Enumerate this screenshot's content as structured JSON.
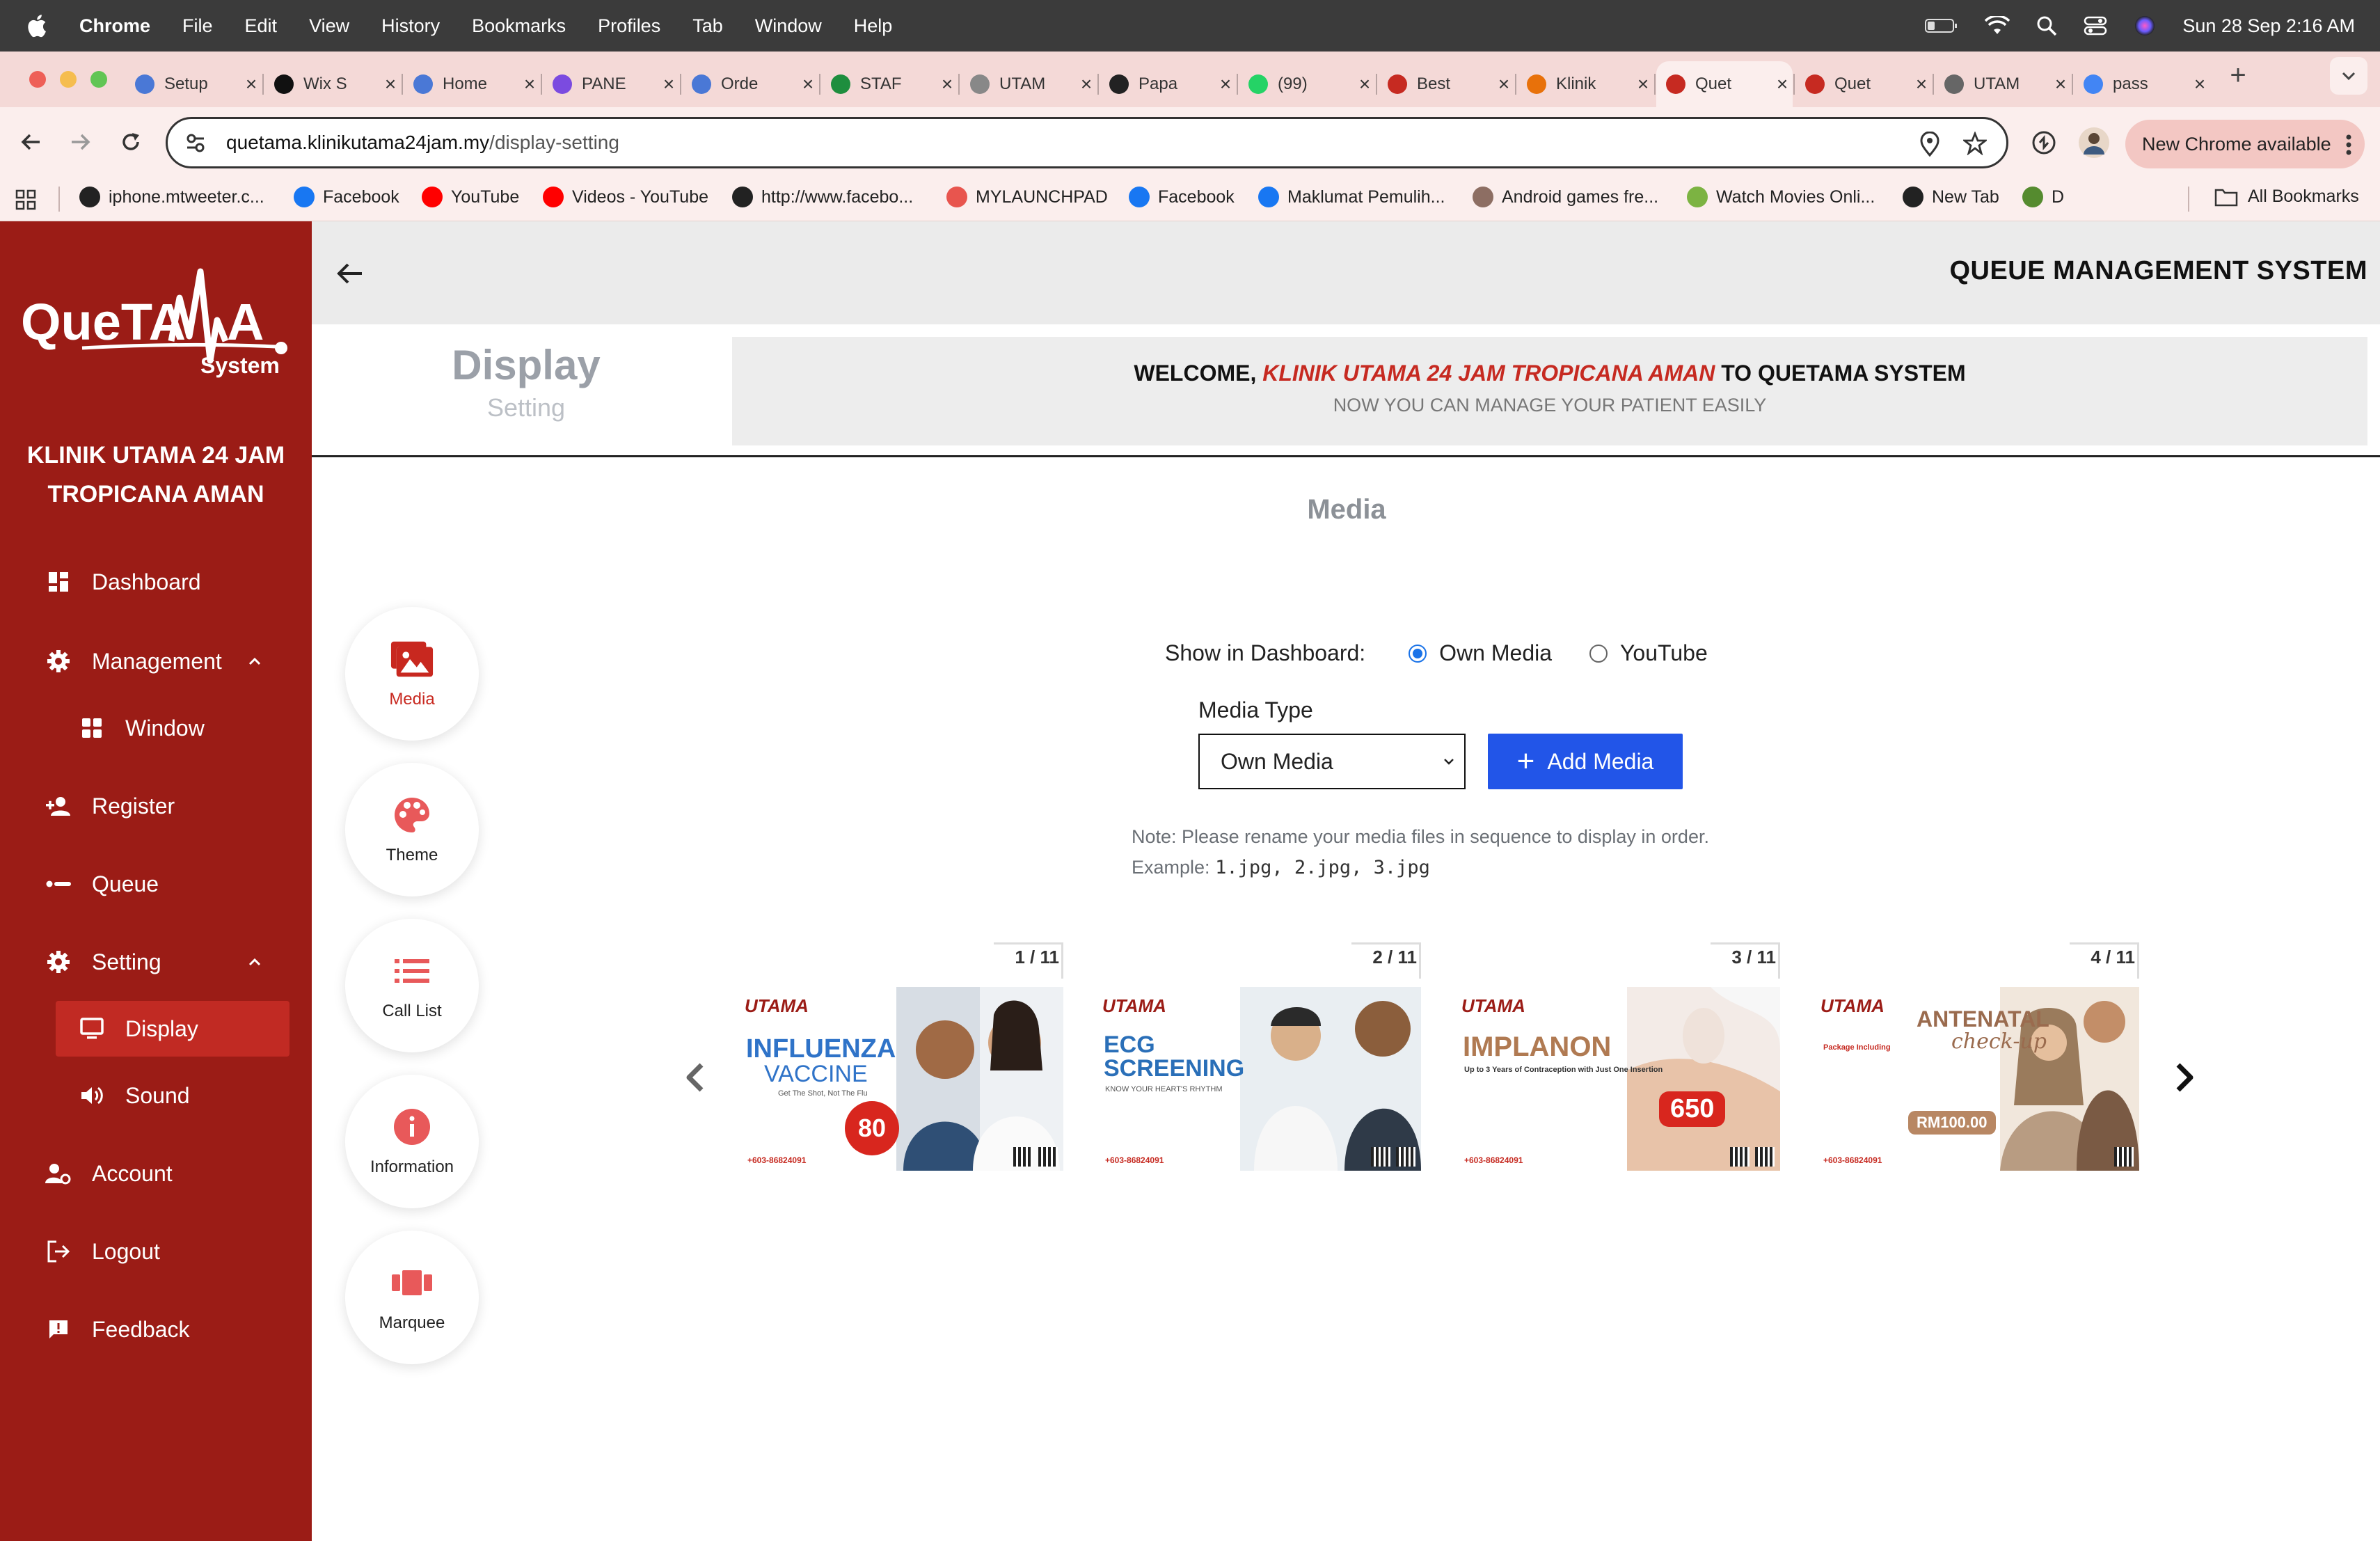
{
  "menubar": {
    "app": "Chrome",
    "items": [
      "File",
      "Edit",
      "View",
      "History",
      "Bookmarks",
      "Profiles",
      "Tab",
      "Window",
      "Help"
    ],
    "clock": "Sun 28 Sep  2:16 AM"
  },
  "tabs": [
    {
      "title": "Setup",
      "color": "#4a78d6"
    },
    {
      "title": "Wix S",
      "color": "#111111"
    },
    {
      "title": "Home",
      "color": "#4a78d6"
    },
    {
      "title": "PANE",
      "color": "#7b4be0"
    },
    {
      "title": "Orde",
      "color": "#4a78d6"
    },
    {
      "title": "STAF",
      "color": "#1e8e3e"
    },
    {
      "title": "UTAM",
      "color": "#888888"
    },
    {
      "title": "Papa",
      "color": "#222222"
    },
    {
      "title": "(99)",
      "color": "#25d366"
    },
    {
      "title": "Best",
      "color": "#c62a21"
    },
    {
      "title": "Klinik",
      "color": "#e8710a"
    },
    {
      "title": "Quet",
      "color": "#c62a21",
      "active": true
    },
    {
      "title": "Quet",
      "color": "#c62a21"
    },
    {
      "title": "UTAM",
      "color": "#666666"
    },
    {
      "title": "pass",
      "color": "#4285f4"
    }
  ],
  "toolbar": {
    "url_host": "quetama.klinikutama24jam.my",
    "url_path": "/display-setting",
    "new_chrome": "New Chrome available"
  },
  "bookmarks": [
    {
      "label": "iphone.mtweeter.c...",
      "color": "#222222"
    },
    {
      "label": "Facebook",
      "color": "#1877f2"
    },
    {
      "label": "YouTube",
      "color": "#ff0000"
    },
    {
      "label": "Videos - YouTube",
      "color": "#ff0000"
    },
    {
      "label": "http://www.facebo...",
      "color": "#222222"
    },
    {
      "label": "MYLAUNCHPAD",
      "color": "#e8554e"
    },
    {
      "label": "Facebook",
      "color": "#1877f2"
    },
    {
      "label": "Maklumat Pemulih...",
      "color": "#1877f2"
    },
    {
      "label": "Android games fre...",
      "color": "#8d6e63"
    },
    {
      "label": "Watch Movies Onli...",
      "color": "#7cb342"
    },
    {
      "label": "New Tab",
      "color": "#222222"
    },
    {
      "label": "D",
      "color": "#558b2f"
    }
  ],
  "all_bookmarks": "All Bookmarks",
  "sidebar": {
    "logo_text": "QueTAMA",
    "logo_sub": "System",
    "clinic_line1": "KLINIK UTAMA 24 JAM",
    "clinic_line2": "TROPICANA AMAN",
    "items": {
      "dashboard": "Dashboard",
      "management": "Management",
      "window": "Window",
      "register": "Register",
      "queue": "Queue",
      "setting": "Setting",
      "display": "Display",
      "sound": "Sound",
      "account": "Account",
      "logout": "Logout",
      "feedback": "Feedback"
    }
  },
  "header": {
    "system_title": "QUEUE MANAGEMENT SYSTEM",
    "display_title": "Display",
    "display_subtitle": "Setting",
    "welcome_prefix": "WELCOME, ",
    "welcome_clinic": "KLINIK UTAMA 24 JAM TROPICANA AMAN",
    "welcome_suffix": " TO QUETAMA SYSTEM",
    "welcome_sub": "NOW YOU CAN MANAGE YOUR PATIENT EASILY"
  },
  "settings_nav": {
    "media": "Media",
    "theme": "Theme",
    "call_list": "Call List",
    "information": "Information",
    "marquee": "Marquee"
  },
  "media": {
    "section_title": "Media",
    "show_label": "Show in Dashboard:",
    "option_own": "Own Media",
    "option_youtube": "YouTube",
    "selected_option": "Own Media",
    "media_type_label": "Media Type",
    "media_type_value": "Own Media",
    "add_button": "Add Media",
    "note_line1": "Note: Please rename your media files in sequence to display in order.",
    "note_example_label": "Example: ",
    "note_example_files": "1.jpg, 2.jpg, 3.jpg"
  },
  "slides": [
    {
      "counter": "1 / 11",
      "brand": "UTAMA",
      "headline1": "INFLUENZA",
      "headline2": "VACCINE",
      "tagline": "Get The Shot, Not The Flu",
      "price": "80",
      "phone": "+603-86824091"
    },
    {
      "counter": "2 / 11",
      "brand": "UTAMA",
      "headline1": "ECG",
      "headline2": "SCREENING",
      "tagline": "KNOW YOUR HEART'S RHYTHM",
      "price": "",
      "phone": "+603-86824091"
    },
    {
      "counter": "3 / 11",
      "brand": "UTAMA",
      "headline1": "IMPLANON",
      "headline2": "",
      "tagline": "Up to 3 Years of Contraception with Just One Insertion",
      "price": "650",
      "phone": "+603-86824091"
    },
    {
      "counter": "4 / 11",
      "brand": "UTAMA",
      "headline1": "ANTENATAL",
      "headline2": "check-up",
      "tagline": "Package Including",
      "price": "RM100.00",
      "phone": "+603-86824091"
    }
  ],
  "colors": {
    "sidebar_bg": "#9b1c16",
    "sidebar_selected": "#c12a23",
    "accent_red": "#c62a21",
    "primary_blue": "#2255e8"
  }
}
